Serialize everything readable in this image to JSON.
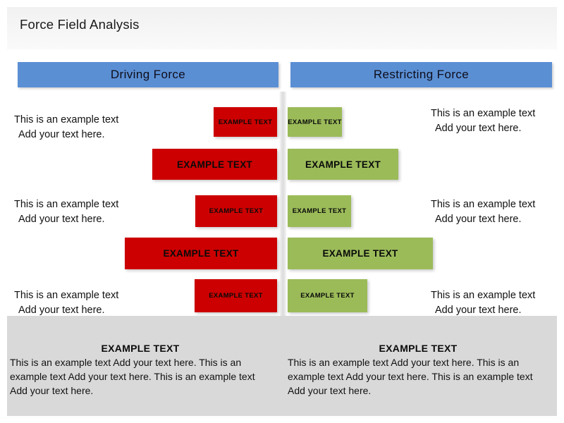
{
  "slide": {
    "title": "Force Field Analysis",
    "background_color": "#ffffff",
    "title_band_color": "#f2f2f2"
  },
  "headers": {
    "left": {
      "label": "Driving  Force",
      "color": "#5b8fd4"
    },
    "right": {
      "label": "Restricting Force",
      "color": "#5b8fd4"
    }
  },
  "colors": {
    "driving_bar": "#cc0000",
    "restricting_bar": "#9bbb59",
    "header": "#5b8fd4",
    "footer_band": "#d9d9d9",
    "divider": "#dcdcdc"
  },
  "rows": [
    {
      "left_text_line1": "This is an example text",
      "left_text_line2": "Add your text here.",
      "right_text_line1": "This is an example text",
      "right_text_line2": "Add your text here.",
      "driving": {
        "label": "EXAMPLE TEXT"
      },
      "restricting": {
        "label": "EXAMPLE TEXT"
      }
    },
    {
      "driving": {
        "label": "EXAMPLE TEXT"
      },
      "restricting": {
        "label": "EXAMPLE TEXT"
      }
    },
    {
      "left_text_line1": "This is an example text",
      "left_text_line2": "Add your text here.",
      "right_text_line1": "This is an example text",
      "right_text_line2": "Add your text here.",
      "driving": {
        "label": "EXAMPLE TEXT"
      },
      "restricting": {
        "label": "EXAMPLE TEXT"
      }
    },
    {
      "driving": {
        "label": "EXAMPLE TEXT"
      },
      "restricting": {
        "label": "EXAMPLE TEXT"
      }
    },
    {
      "left_text_line1": "This is an example text",
      "left_text_line2": "Add your text here.",
      "right_text_line1": "This is an example text",
      "right_text_line2": "Add your text here.",
      "driving": {
        "label": "EXAMPLE TEXT"
      },
      "restricting": {
        "label": "EXAMPLE TEXT"
      }
    }
  ],
  "footer": {
    "left": {
      "heading": "EXAMPLE TEXT",
      "body": "This is an example text  Add your text here. This is an example text  Add your text here. This is an example text Add your text here."
    },
    "right": {
      "heading": "EXAMPLE TEXT",
      "body": "This is an example text  Add your text here. This is an example text  Add your text here. This is an example text Add your text here."
    }
  }
}
